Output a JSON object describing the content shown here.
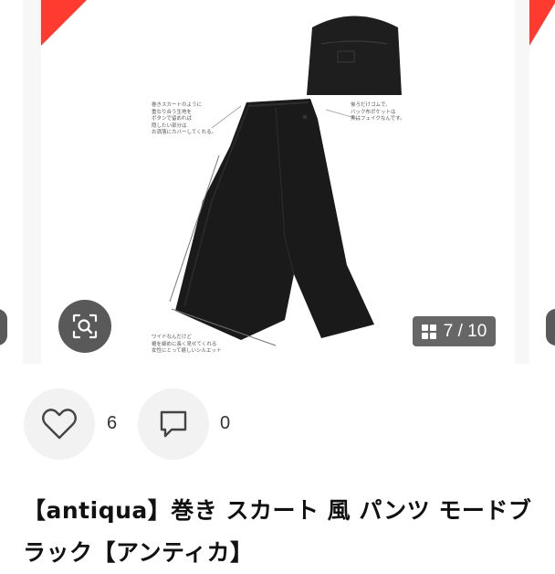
{
  "gallery": {
    "counter_current": "7",
    "counter_separator": "/",
    "counter_total": "10",
    "zoom_icon": "search-zoom-icon",
    "grid_icon": "grid-icon",
    "ribbon_color": "#ff3b30",
    "notes": {
      "left": "巻きスカートのように\n重なり合う生地を\nボタンで留めれば\n隠したい部分は\nお洒落にカバーしてくれる。",
      "right": "後ろだけゴムで、\nバック布ポケットは\n実はフェイクなんです。",
      "bottom": "ワイドなんだけど\n裾を細めに長く見せてくれる\n女性にとって嬉しいシルエット"
    }
  },
  "actions": {
    "like_icon": "heart-icon",
    "like_count": "6",
    "comment_icon": "comment-icon",
    "comment_count": "0"
  },
  "product": {
    "title": "【antiqua】巻き スカート 風 パンツ モードブラック【アンティカ】"
  }
}
